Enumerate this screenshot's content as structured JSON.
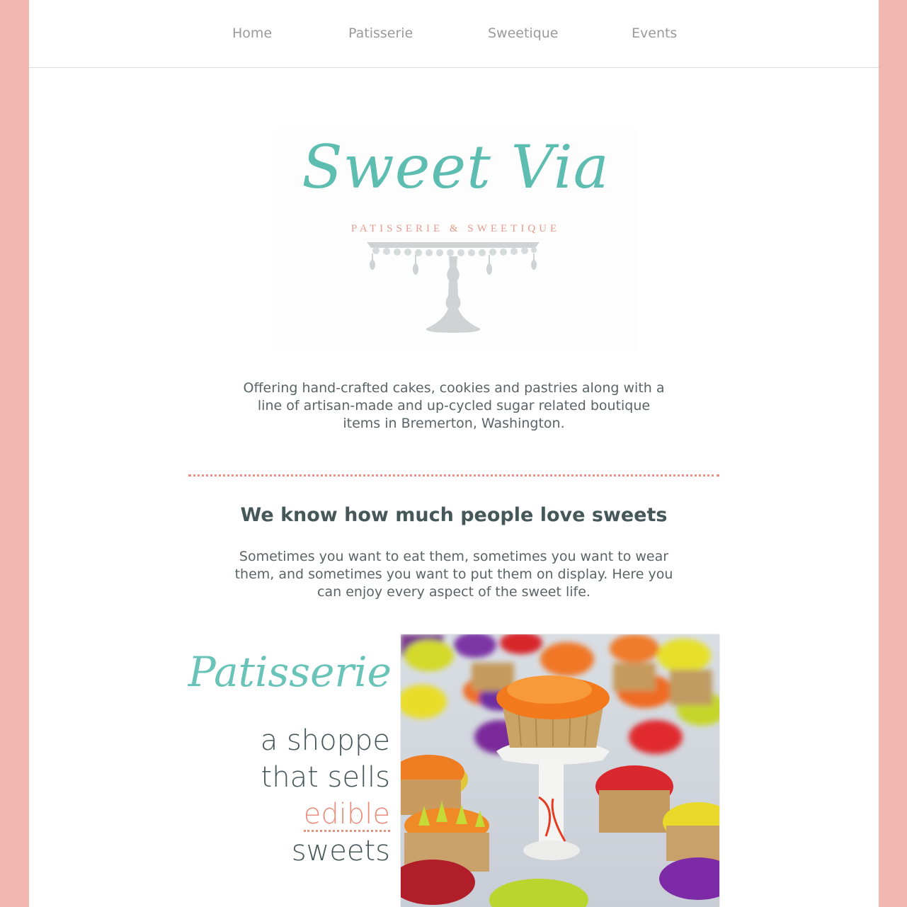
{
  "nav": {
    "items": [
      "Home",
      "Patisserie",
      "Sweetique",
      "Events"
    ]
  },
  "logo": {
    "script": "Sweet Via",
    "subtitle": "PATISSERIE & SWEETIQUE"
  },
  "intro": {
    "text": "Offering hand-crafted cakes, cookies and pastries along with a line of artisan-made and up-cycled sugar related boutique items in Bremerton, Washington."
  },
  "about": {
    "headline": "We know how much people love sweets",
    "text": "Sometimes you want to eat them, sometimes you want to wear them, and sometimes you want to put them on display. Here you can enjoy every aspect of the sweet life."
  },
  "patisserie": {
    "title": "Patisserie",
    "tagline_1": "a shoppe",
    "tagline_2": "that sells",
    "tagline_accent": "edible",
    "tagline_3": "sweets"
  },
  "colors": {
    "background": "#f2b8b0",
    "teal": "#5cbdb0",
    "coral": "#e8907f",
    "text": "#46575a"
  }
}
